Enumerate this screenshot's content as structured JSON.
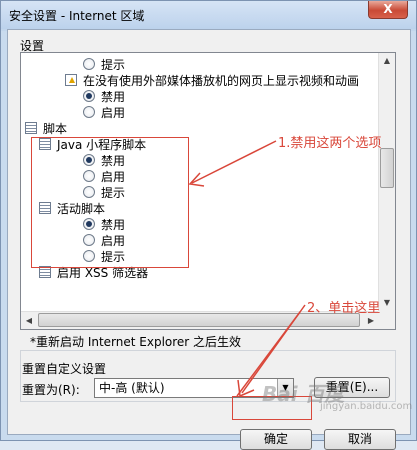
{
  "window": {
    "title": "安全设置 - Internet 区域",
    "close_label": "X"
  },
  "settings_group": {
    "label": "设置",
    "items": [
      {
        "kind": "radio",
        "label": "提示",
        "checked": false
      },
      {
        "kind": "category",
        "label": "在没有使用外部媒体播放机的网页上显示视频和动画"
      },
      {
        "kind": "radio",
        "label": "禁用",
        "checked": true
      },
      {
        "kind": "radio",
        "label": "启用",
        "checked": false
      },
      {
        "kind": "section",
        "label": "脚本"
      },
      {
        "kind": "category",
        "label": "Java 小程序脚本"
      },
      {
        "kind": "radio",
        "label": "禁用",
        "checked": true
      },
      {
        "kind": "radio",
        "label": "启用",
        "checked": false
      },
      {
        "kind": "radio",
        "label": "提示",
        "checked": false
      },
      {
        "kind": "category",
        "label": "活动脚本"
      },
      {
        "kind": "radio",
        "label": "禁用",
        "checked": true
      },
      {
        "kind": "radio",
        "label": "启用",
        "checked": false
      },
      {
        "kind": "radio",
        "label": "提示",
        "checked": false
      },
      {
        "kind": "category",
        "label": "启用 XSS 筛选器"
      }
    ]
  },
  "note": "*重新启动 Internet Explorer 之后生效",
  "reset": {
    "group_label": "重置自定义设置",
    "reset_to_label": "重置为(R):",
    "select_value": "中-高 (默认)",
    "reset_button": "重置(E)..."
  },
  "buttons": {
    "ok": "确定",
    "cancel": "取消"
  },
  "annotations": {
    "step1": "1.禁用这两个选项",
    "step2": "2、单击这里"
  },
  "watermark": {
    "brand": "Bai 百度",
    "sub": "jingyan.baidu.com"
  },
  "colors": {
    "annotation": "#d9473a"
  }
}
